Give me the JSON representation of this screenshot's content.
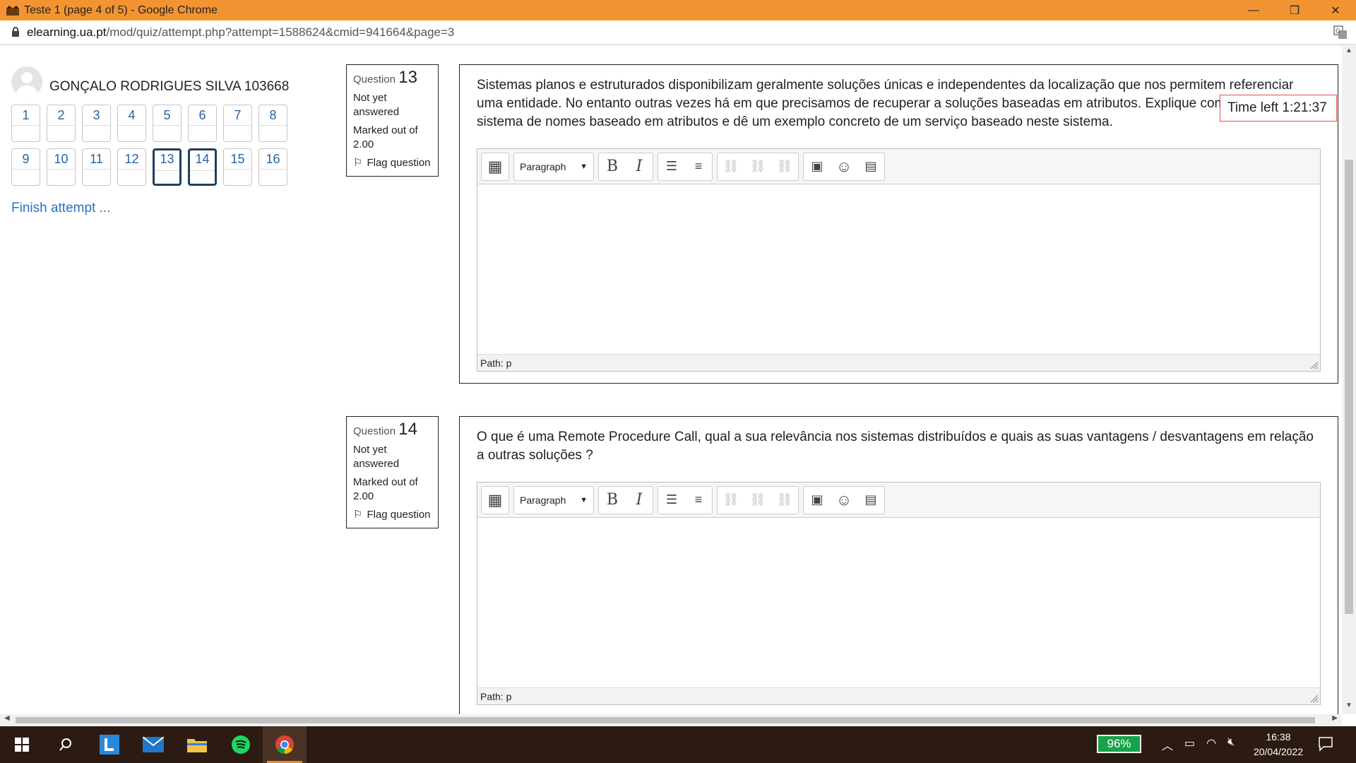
{
  "window": {
    "title": "Teste 1 (page 4 of 5) - Google Chrome",
    "minimize": "—",
    "restore": "❐",
    "close": "✕"
  },
  "address": {
    "host": "elearning.ua.pt",
    "path": "/mod/quiz/attempt.php?attempt=1588624&cmid=941664&page=3"
  },
  "user": {
    "name": "GONÇALO RODRIGUES SILVA 103668"
  },
  "navigation": {
    "row1": [
      "1",
      "2",
      "3",
      "4",
      "5",
      "6",
      "7",
      "8"
    ],
    "row2": [
      "9",
      "10",
      "11",
      "12",
      "13",
      "14",
      "15",
      "16"
    ],
    "current": [
      "13",
      "14"
    ],
    "finish": "Finish attempt ..."
  },
  "timer": {
    "text": "Time left 1:21:37"
  },
  "questions": [
    {
      "label": "Question",
      "number": "13",
      "state": "Not yet answered",
      "marks": "Marked out of 2.00",
      "flag": "Flag question",
      "text": "Sistemas planos e estruturados disponibilizam geralmente soluções únicas e independentes da localização que nos permitem referenciar uma entidade. No entanto outras vezes há em que precisamos de recuperar a soluções baseadas em atributos. Explique como funciona um sistema de nomes baseado em atributos e dê um exemplo concreto de um serviço baseado neste sistema.",
      "format": "Paragraph",
      "path": "Path: p"
    },
    {
      "label": "Question",
      "number": "14",
      "state": "Not yet answered",
      "marks": "Marked out of 2.00",
      "flag": "Flag question",
      "text": "O que é uma Remote Procedure Call, qual a sua relevância nos sistemas distribuídos e quais as suas vantagens / desvantagens em relação a outras soluções ?",
      "format": "Paragraph",
      "path": "Path: p"
    }
  ],
  "taskbar": {
    "battery": "96%",
    "time": "16:38",
    "date": "20/04/2022"
  },
  "colors": {
    "titlebar": "#f39433",
    "link": "#2a72c2",
    "taskbar": "#2b1b12",
    "battery": "#16a34a"
  }
}
